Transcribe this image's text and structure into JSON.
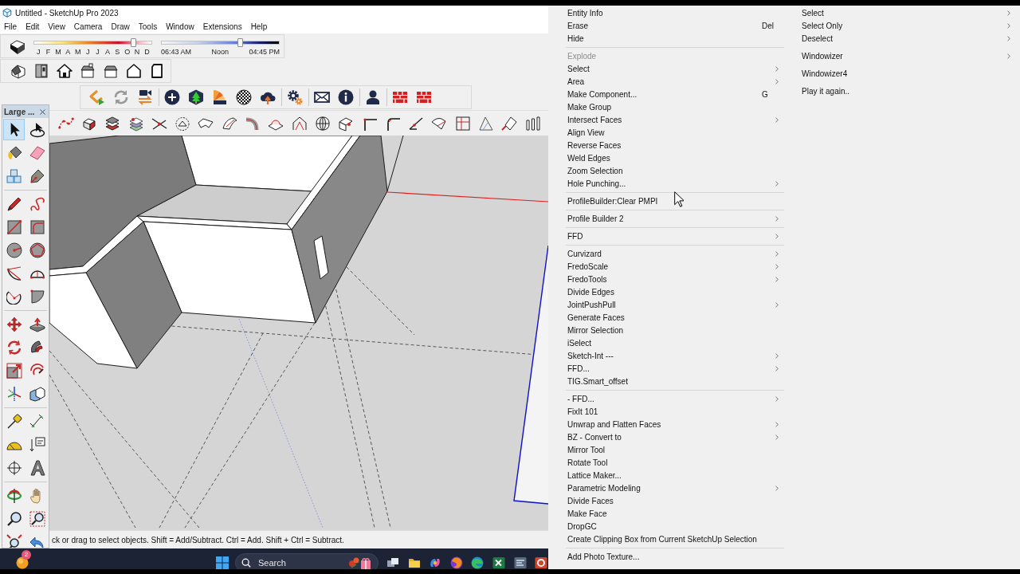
{
  "window": {
    "title": "Untitled - SketchUp Pro 2023"
  },
  "menu_bar": [
    "File",
    "Edit",
    "View",
    "Camera",
    "Draw",
    "Tools",
    "Window",
    "Extensions",
    "Help"
  ],
  "shadow_toolbar": {
    "months": [
      "J",
      "F",
      "M",
      "A",
      "M",
      "J",
      "J",
      "A",
      "S",
      "O",
      "N",
      "D"
    ],
    "month_slider": {
      "level": 0.84
    },
    "time_labels": [
      "06:43 AM",
      "Noon",
      "04:45 PM"
    ],
    "time_slider": {
      "level": 0.67
    }
  },
  "large_toolset": {
    "title": "Large ...",
    "tools": [
      {
        "selected": true
      },
      {
        "selected": false
      },
      {
        "selected": false
      },
      {
        "selected": false
      },
      {
        "selected": false
      },
      {
        "selected": false
      },
      {
        "selected": false
      },
      {
        "selected": false
      },
      {
        "selected": false
      },
      {
        "selected": false
      },
      {
        "selected": false
      },
      {
        "selected": false
      },
      {
        "selected": false
      },
      {
        "selected": false
      },
      {
        "selected": false
      },
      {
        "selected": false
      },
      {
        "selected": false
      },
      {
        "selected": false
      },
      {
        "selected": false
      },
      {
        "selected": false
      },
      {
        "selected": false
      },
      {
        "selected": false
      },
      {
        "selected": false
      },
      {
        "selected": false
      },
      {
        "selected": false
      },
      {
        "selected": false
      },
      {
        "selected": false
      },
      {
        "selected": false
      },
      {
        "selected": false
      },
      {
        "selected": false
      },
      {
        "selected": false
      },
      {
        "selected": false
      },
      {
        "selected": false
      },
      {
        "selected": false
      },
      {
        "selected": false
      },
      {
        "selected": false
      }
    ]
  },
  "status_bar": {
    "text": "ck or drag to select objects. Shift = Add/Subtract. Ctrl = Add. Shift + Ctrl = Subtract."
  },
  "taskbar": {
    "badge": "2",
    "search": {
      "placeholder": "Search"
    }
  },
  "context_menu": {
    "items": [
      {
        "kind": "item",
        "label": "Entity Info",
        "has_submenu": false,
        "disabled": false
      },
      {
        "kind": "item",
        "label": "Erase",
        "shortcut": "Del",
        "has_submenu": false,
        "disabled": false
      },
      {
        "kind": "item",
        "label": "Hide",
        "has_submenu": false,
        "disabled": false
      },
      {
        "kind": "separator"
      },
      {
        "kind": "item",
        "label": "Explode",
        "has_submenu": false,
        "disabled": true
      },
      {
        "kind": "item",
        "label": "Select",
        "has_submenu": true,
        "disabled": false
      },
      {
        "kind": "item",
        "label": "Area",
        "has_submenu": true,
        "disabled": false
      },
      {
        "kind": "item",
        "label": "Make Component...",
        "shortcut": "G",
        "has_submenu": false,
        "disabled": false
      },
      {
        "kind": "item",
        "label": "Make Group",
        "has_submenu": false,
        "disabled": false
      },
      {
        "kind": "item",
        "label": "Intersect Faces",
        "has_submenu": true,
        "disabled": false
      },
      {
        "kind": "item",
        "label": "Align View",
        "has_submenu": false,
        "disabled": false
      },
      {
        "kind": "item",
        "label": "Reverse Faces",
        "has_submenu": false,
        "disabled": false
      },
      {
        "kind": "item",
        "label": "Weld Edges",
        "has_submenu": false,
        "disabled": false
      },
      {
        "kind": "item",
        "label": "Zoom Selection",
        "has_submenu": false,
        "disabled": false
      },
      {
        "kind": "item",
        "label": "Hole Punching...",
        "has_submenu": true,
        "disabled": false
      },
      {
        "kind": "separator"
      },
      {
        "kind": "item",
        "label": "ProfileBuilder:Clear PMPI",
        "has_submenu": false,
        "disabled": false
      },
      {
        "kind": "separator"
      },
      {
        "kind": "item",
        "label": "Profile Builder 2",
        "has_submenu": true,
        "disabled": false
      },
      {
        "kind": "separator"
      },
      {
        "kind": "item",
        "label": "FFD",
        "has_submenu": true,
        "disabled": false
      },
      {
        "kind": "separator"
      },
      {
        "kind": "item",
        "label": "Curvizard",
        "has_submenu": true,
        "disabled": false
      },
      {
        "kind": "item",
        "label": "FredoScale",
        "has_submenu": true,
        "disabled": false
      },
      {
        "kind": "item",
        "label": "FredoTools",
        "has_submenu": true,
        "disabled": false
      },
      {
        "kind": "item",
        "label": "Divide Edges",
        "has_submenu": false,
        "disabled": false
      },
      {
        "kind": "item",
        "label": "JointPushPull",
        "has_submenu": true,
        "disabled": false
      },
      {
        "kind": "item",
        "label": "Generate Faces",
        "has_submenu": false,
        "disabled": false
      },
      {
        "kind": "item",
        "label": "Mirror Selection",
        "has_submenu": false,
        "disabled": false
      },
      {
        "kind": "item",
        "label": "iSelect",
        "has_submenu": false,
        "disabled": false
      },
      {
        "kind": "item",
        "label": "Sketch-Int ---",
        "has_submenu": true,
        "disabled": false
      },
      {
        "kind": "item",
        "label": "FFD...",
        "has_submenu": true,
        "disabled": false
      },
      {
        "kind": "item",
        "label": "TIG.Smart_offset",
        "has_submenu": false,
        "disabled": false
      },
      {
        "kind": "separator"
      },
      {
        "kind": "item",
        "label": "- FFD...",
        "has_submenu": true,
        "disabled": false
      },
      {
        "kind": "item",
        "label": "FixIt 101",
        "has_submenu": false,
        "disabled": false
      },
      {
        "kind": "item",
        "label": "Unwrap and Flatten Faces",
        "has_submenu": true,
        "disabled": false
      },
      {
        "kind": "item",
        "label": "BZ - Convert to",
        "has_submenu": true,
        "disabled": false
      },
      {
        "kind": "item",
        "label": "Mirror Tool",
        "has_submenu": false,
        "disabled": false
      },
      {
        "kind": "item",
        "label": "Rotate Tool",
        "has_submenu": false,
        "disabled": false
      },
      {
        "kind": "item",
        "label": "Lattice Maker...",
        "has_submenu": false,
        "disabled": false
      },
      {
        "kind": "item",
        "label": "Parametric Modeling",
        "has_submenu": true,
        "disabled": false
      },
      {
        "kind": "item",
        "label": "Divide Faces",
        "has_submenu": false,
        "disabled": false
      },
      {
        "kind": "item",
        "label": "Make Face",
        "has_submenu": false,
        "disabled": false
      },
      {
        "kind": "item",
        "label": "DropGC",
        "has_submenu": false,
        "disabled": false
      },
      {
        "kind": "item",
        "label": "Create Clipping Box from Current SketchUp Selection",
        "has_submenu": false,
        "disabled": false
      },
      {
        "kind": "separator"
      },
      {
        "kind": "item",
        "label": "Add Photo Texture...",
        "has_submenu": false,
        "disabled": false
      }
    ]
  },
  "submenu": {
    "items": [
      {
        "kind": "item",
        "label": "Select",
        "has_submenu": true
      },
      {
        "kind": "item",
        "label": "Select Only",
        "has_submenu": true
      },
      {
        "kind": "item",
        "label": "Deselect",
        "has_submenu": true
      },
      {
        "kind": "gap"
      },
      {
        "kind": "item",
        "label": "Windowizer",
        "has_submenu": true
      },
      {
        "kind": "gap"
      },
      {
        "kind": "item",
        "label": "Windowizer4",
        "has_submenu": false
      },
      {
        "kind": "gap"
      },
      {
        "kind": "item",
        "label": "Play it again..",
        "has_submenu": false
      }
    ]
  }
}
